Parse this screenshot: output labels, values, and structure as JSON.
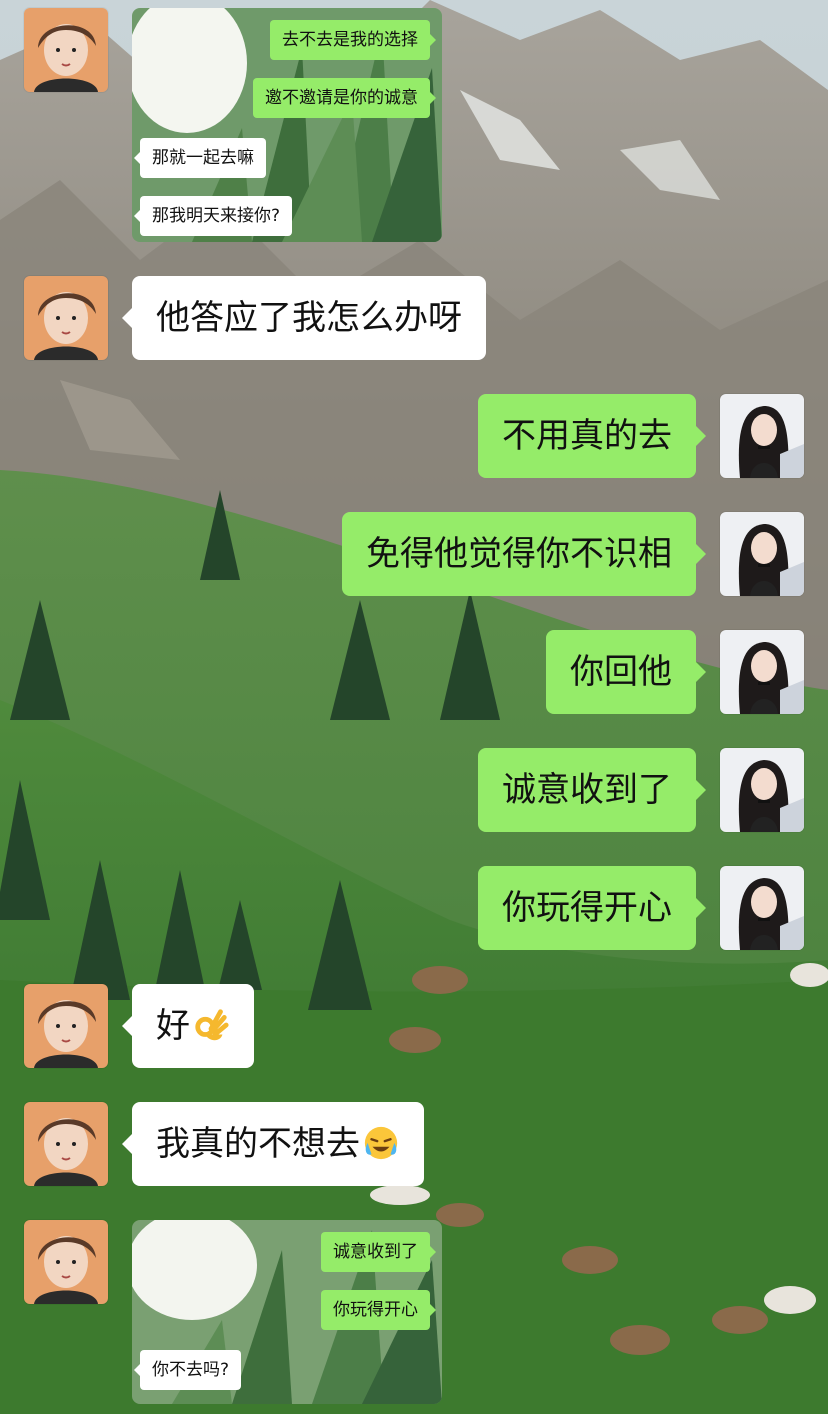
{
  "screenshot1": {
    "messages": [
      {
        "side": "right",
        "text": "去不去是我的选择"
      },
      {
        "side": "right",
        "text": "邀不邀请是你的诚意"
      },
      {
        "side": "left",
        "text": "那就一起去嘛"
      },
      {
        "side": "left",
        "text": "那我明天来接你?"
      }
    ]
  },
  "messages": [
    {
      "side": "left",
      "text": "他答应了我怎么办呀"
    },
    {
      "side": "right",
      "text": "不用真的去"
    },
    {
      "side": "right",
      "text": "免得他觉得你不识相"
    },
    {
      "side": "right",
      "text": "你回他"
    },
    {
      "side": "right",
      "text": "诚意收到了"
    },
    {
      "side": "right",
      "text": "你玩得开心"
    },
    {
      "side": "left",
      "text": "好",
      "emoji": "ok-hand-emoji"
    },
    {
      "side": "left",
      "text": "我真的不想去",
      "emoji": "crying-laughing-emoji"
    }
  ],
  "screenshot2": {
    "messages": [
      {
        "side": "right",
        "text": "诚意收到了"
      },
      {
        "side": "right",
        "text": "你玩得开心"
      },
      {
        "side": "left",
        "text": "你不去吗?"
      }
    ]
  },
  "colors": {
    "bubble_green": "#95ec69",
    "bubble_white": "#ffffff"
  }
}
